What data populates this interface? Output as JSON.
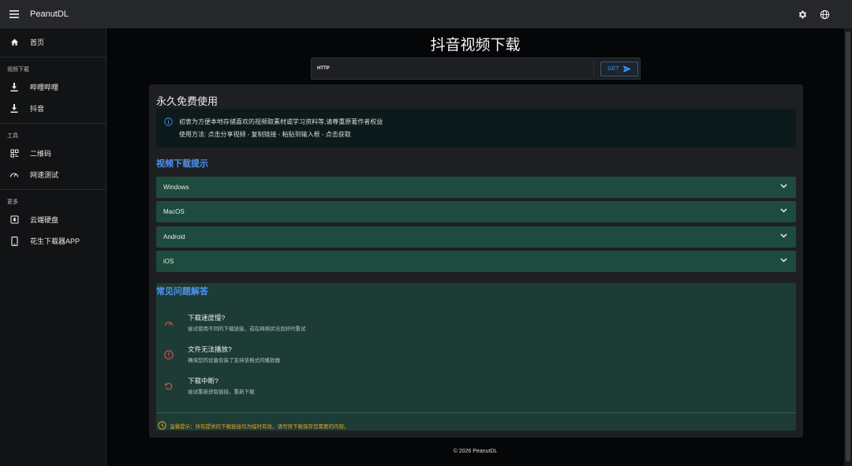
{
  "app": {
    "brand": "PeanutDL"
  },
  "sidebar": {
    "home": "首页",
    "section_video": "视频下载",
    "bilibili": "哔哩哔哩",
    "douyin": "抖音",
    "section_tools": "工具",
    "qrcode": "二维码",
    "speedtest": "网速测试",
    "section_more": "更多",
    "cloud": "云端硬盘",
    "app": "花生下载器APP"
  },
  "main": {
    "title": "抖音视频下载",
    "url_label": "HTTP",
    "url_value": "",
    "get_label": "GET"
  },
  "card": {
    "title": "永久免费使用",
    "info_line1": "初衷为方便本地存储喜欢的视频取素材或学习资料等,请尊重原著作者权益",
    "info_line2": "使用方法: 点击分享视频 - 复制链接 - 粘贴到输入框 - 点击获取",
    "tips_title": "视频下载提示",
    "accordions": [
      "Windows",
      "MacOS",
      "Android",
      "iOS"
    ],
    "faq_title": "常见问题解答",
    "faq": [
      {
        "q": "下载速度慢?",
        "a": "尝试使用不同的下载链接，或在网络状况良好时重试",
        "icon": "speedometer-icon"
      },
      {
        "q": "文件无法播放?",
        "a": "确保您的设备安装了支持该格式的播放器",
        "icon": "alert-circle-icon"
      },
      {
        "q": "下载中断?",
        "a": "尝试重新获取链接，重新下载",
        "icon": "refresh-icon"
      }
    ],
    "note": "温馨提示：所有提供的下载链接均为临时有效，请尽快下载保存您需要的内容。"
  },
  "footer": "© 2026 PeanutDL",
  "colors": {
    "accent": "#4d94f0",
    "accordion": "#1d4b3e",
    "faq_bg": "#1d3c36",
    "warn": "#e0a52a",
    "faq_icon": "#e0504a"
  }
}
